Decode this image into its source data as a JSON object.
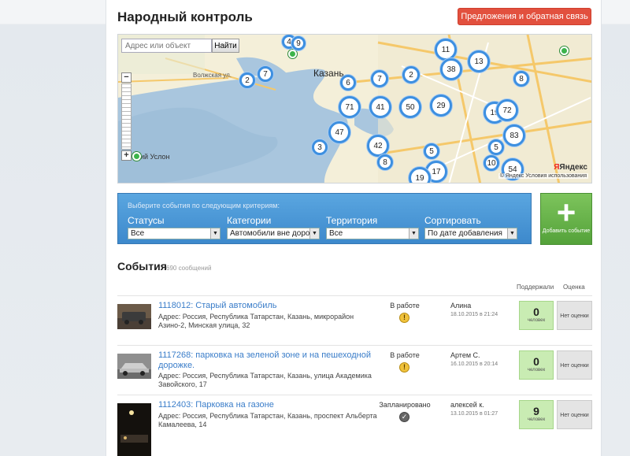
{
  "app": {
    "title": "Народный контроль",
    "feedback_label": "Предложения и обратная связь"
  },
  "map": {
    "search_placeholder": "Адрес или объект",
    "search_button": "Найти",
    "city_label": "Казань",
    "street_label": "Волжская ул.",
    "town_label": "ий Услон",
    "brand": "Яндекс",
    "terms": "© Яндекс Условия использования",
    "clusters": [
      "4",
      "9",
      "2",
      "7",
      "6",
      "7",
      "2",
      "11",
      "38",
      "13",
      "8",
      "71",
      "41",
      "50",
      "29",
      "19",
      "72",
      "47",
      "42",
      "8",
      "3",
      "5",
      "17",
      "19",
      "5",
      "10",
      "83",
      "54"
    ]
  },
  "filter": {
    "hint": "Выберите события по следующим критериям:",
    "groups": [
      {
        "label": "Статусы",
        "value": "Все"
      },
      {
        "label": "Категории",
        "value": "Автомобили вне доро"
      },
      {
        "label": "Территория",
        "value": "Все"
      },
      {
        "label": "Сортировать",
        "value": "По дате добавления"
      }
    ]
  },
  "add_button": {
    "label": "Добавить событие"
  },
  "events": {
    "title": "События",
    "count": "690 сообщений",
    "col_support": "Поддержали",
    "col_rating": "Оценка",
    "items": [
      {
        "title": "1118012: Старый автомобиль",
        "address": "Адрес: Россия, Республика Татарстан, Казань, микрорайон Азино-2, Минская улица, 32",
        "status": "В работе",
        "author": "Алина",
        "date": "18.10.2015 в 21:24",
        "support": "0",
        "support_caption": "человек",
        "rating": "Нет оценки"
      },
      {
        "title": "1117268: парковка на зеленой зоне и на пешеходной дорожке.",
        "address": "Адрес: Россия, Республика Татарстан, Казань, улица Академика Завойского, 17",
        "status": "В работе",
        "author": "Артем С.",
        "date": "16.10.2015 в 20:14",
        "support": "0",
        "support_caption": "человек",
        "rating": "Нет оценки"
      },
      {
        "title": "1112403: Парковка на газоне",
        "address": "Адрес: Россия, Республика Татарстан, Казань, проспект Альберта Камалеева, 14",
        "status": "Запланировано",
        "author": "алексей к.",
        "date": "13.10.2015 в 01:27",
        "support": "9",
        "support_caption": "человек",
        "rating": "Нет оценки"
      }
    ]
  }
}
